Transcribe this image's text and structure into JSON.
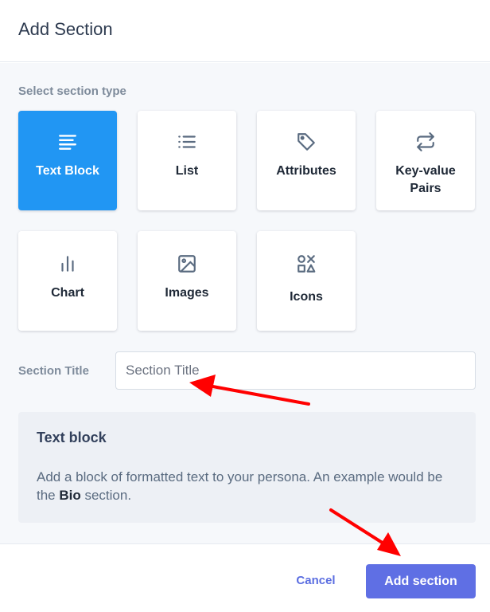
{
  "dialog": {
    "title": "Add Section"
  },
  "section_type": {
    "label": "Select section type",
    "options": [
      {
        "label": "Text Block",
        "icon": "align-left-icon",
        "selected": true
      },
      {
        "label": "List",
        "icon": "list-icon",
        "selected": false
      },
      {
        "label": "Attributes",
        "icon": "tag-icon",
        "selected": false
      },
      {
        "label": "Key-value Pairs",
        "icon": "repeat-icon",
        "selected": false
      },
      {
        "label": "Chart",
        "icon": "bar-chart-icon",
        "selected": false
      },
      {
        "label": "Images",
        "icon": "image-icon",
        "selected": false
      },
      {
        "label": "Icons",
        "icon": "shapes-icon",
        "selected": false
      }
    ]
  },
  "section_title": {
    "label": "Section Title",
    "placeholder": "Section Title",
    "value": ""
  },
  "info": {
    "title": "Text block",
    "description_prefix": "Add a block of formatted text to your persona. An example would be the ",
    "description_bold": "Bio",
    "description_suffix": " section."
  },
  "footer": {
    "cancel_label": "Cancel",
    "add_label": "Add section"
  },
  "colors": {
    "accent": "#2196f3",
    "primary_button": "#5f6fe4",
    "link": "#5b6ee1",
    "annotation_arrow": "#ff0000"
  }
}
